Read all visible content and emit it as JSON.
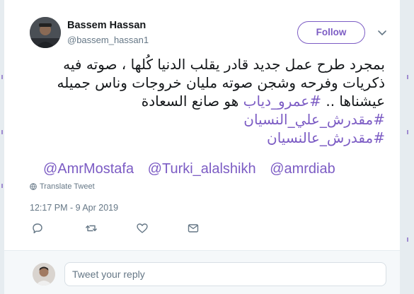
{
  "tweet": {
    "author": {
      "name": "Bassem Hassan",
      "handle": "@bassem_hassan1",
      "avatar_icon": "user-avatar"
    },
    "follow_label": "Follow",
    "menu_icon": "chevron-down-icon",
    "text_lines": [
      "بمجرد طرح عمل جديد قادر يقلب الدنيا كُلها ، صوته فيه",
      "ذكريات وفرحه وشجن صوته مليان خروجات وناس جميله",
      "عيشناها .."
    ],
    "inline_hashtag": "#عمرو_دياب",
    "line3_suffix": "هو صانع السعادة",
    "hashtags": [
      "#مقدرش_علي_النسيان",
      "#مقدرش_عالنسيان"
    ],
    "mentions": [
      "@AmrMostafa",
      "@Turki_alalshikh",
      "@amrdiab"
    ],
    "translate_label": "Translate Tweet",
    "timestamp": "12:17 PM - 9 Apr 2019",
    "actions": [
      "reply-icon",
      "retweet-icon",
      "like-icon",
      "message-icon"
    ]
  },
  "reply": {
    "placeholder": "Tweet your reply"
  },
  "colors": {
    "accent": "#7c5cc4",
    "text": "#14171a",
    "muted": "#657786",
    "border": "#e6ecf0"
  }
}
